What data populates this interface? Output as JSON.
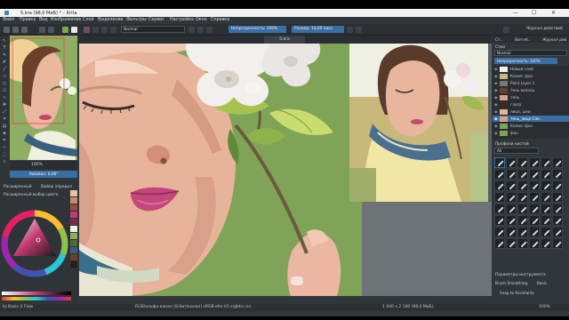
{
  "window": {
    "title": "5.kra (98,0 МиБ) * – Krita",
    "minimize": "—",
    "maximize": "☐",
    "close": "✕"
  },
  "menu": [
    "Файл",
    "Правка",
    "Вид",
    "Изображение",
    "Слой",
    "Выделение",
    "Фильтры",
    "Сервис",
    "Настройка",
    "Окно",
    "Справка"
  ],
  "toolbar": {
    "blend_mode": "Normal",
    "opacity_label": "Непрозрачность: 100%",
    "size_label": "Размер: 14,08 пикс.",
    "workspace_label": "Журнал действий"
  },
  "document_tab": "5.kra",
  "overview": {
    "zoom": "100%",
    "rotation": "Rotation: 0,00°"
  },
  "left_panels": {
    "advanced_color": "Расширенный",
    "color_picker_tab": "Выбор определ",
    "advanced_selector": "Расширенный выбор цвета"
  },
  "right_panel": {
    "tabs": [
      "Ст..",
      "Bonnet..",
      "Журнал дей.."
    ],
    "layers_title": "Слои",
    "blend": "Normal",
    "opacity": "Непрозрачность: 100%",
    "layers": [
      {
        "name": "Новый слой",
        "active": false
      },
      {
        "name": "Копия: фон",
        "active": false
      },
      {
        "name": "Paint Layer 1",
        "active": false
      },
      {
        "name": "тень волосы",
        "active": false
      },
      {
        "name": "тень",
        "active": false
      },
      {
        "name": "глаза",
        "active": false
      },
      {
        "name": "лицо, шеи",
        "active": false
      },
      {
        "name": "тень_лицо Сле..",
        "active": true
      },
      {
        "name": "Копия: фон",
        "active": false
      },
      {
        "name": "фон",
        "active": false
      }
    ],
    "brush_presets_title": "Профили кистей",
    "brush_filter": "All",
    "tools_options_title": "Параметры инструмента",
    "brush_label": "Brush Smoothing:",
    "brush_value": "Basic",
    "snap_label": "Snap to Assistants"
  },
  "status": {
    "brush": "b) Basic-3 Flow",
    "colorspace": "RGB/альфа-канал (8-бит/канал)  sRGB-elle-V2-srgbtrc.icc",
    "dimensions": "1 440 x 2 160 (98,0 МиБ)",
    "zoom": "100%"
  },
  "colors": {
    "accent": "#3a6ea5",
    "bg_green": "#7fa357",
    "panel": "#31363b"
  }
}
